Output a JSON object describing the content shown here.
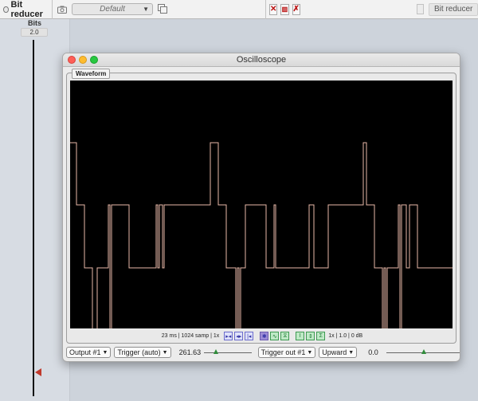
{
  "plugin_header": {
    "plugin_name": "Bit reducer",
    "preset_value": "Default",
    "right_title": "Bit reducer",
    "icons": [
      "power-icon",
      "camera-icon",
      "copy-icon",
      "close-x-icon",
      "compare-icon",
      "remove-icon"
    ]
  },
  "parameter": {
    "label": "Bits",
    "value": "2.0"
  },
  "window": {
    "title": "Oscilloscope",
    "group_tab": "Waveform"
  },
  "scope": {
    "info": "23 ms | 1024 samp | 1x",
    "status": "1x | 1.0 | 0 dB"
  },
  "controls": {
    "output": "Output #1",
    "trigger_mode": "Trigger (auto)",
    "frequency": "261.63",
    "frequency_slider_position": 0.24,
    "trigger_out": "Trigger out #1",
    "direction": "Upward",
    "threshold": "0.0",
    "threshold_slider_position": 0.5
  },
  "colors": {
    "waveform": "#e8b9a8",
    "slider_marker": "#c0392b",
    "slider_thumb": "#2e8b3a"
  }
}
